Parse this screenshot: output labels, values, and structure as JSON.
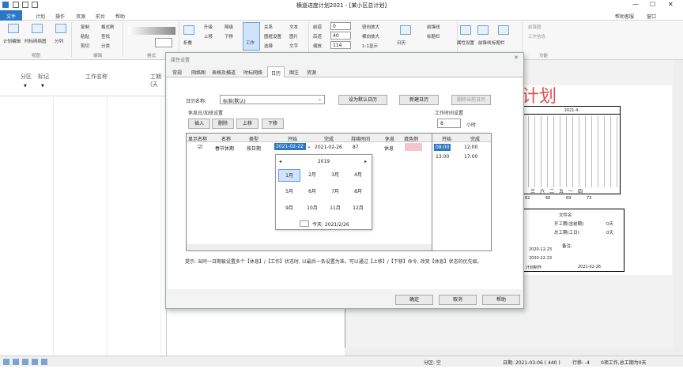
{
  "app": {
    "title": "横道进度计划2021 - [某小区总计划]"
  },
  "tabs": [
    "文件",
    "计划",
    "操作",
    "资源",
    "前台",
    "帮助"
  ],
  "ribbon": {
    "right_help": "帮助客服",
    "right_window": "窗口",
    "items": [
      "计划编辑",
      "时标网络图",
      "分列",
      "复制",
      "粘贴",
      "剪切",
      "格式刷",
      "查找",
      "分类",
      "折叠",
      "升级",
      "上移",
      "降级",
      "下移",
      "工作",
      "关系",
      "图框设置",
      "选择",
      "文本",
      "图片",
      "文字",
      "前道",
      "后道",
      "缩放",
      "竖向放大",
      "横向放大",
      "1:1显示",
      "24",
      "40",
      "114",
      "0",
      "前锋线",
      "标题栏",
      "日历",
      "属性设置",
      "前锋图",
      "工作信息",
      "隐藏",
      "显示"
    ],
    "groups": [
      "视图",
      "编辑",
      "格式",
      "对象",
      "视图",
      "显示",
      "配置",
      "功能"
    ]
  },
  "left_header": {
    "col_area": "分区",
    "col_mark": "标记",
    "col_name": "工作名称",
    "col_days": "工期(天"
  },
  "right_pane": {
    "big_title": "计划",
    "cal_header": "2021.4",
    "weekdays": [
      "三",
      "六",
      "二",
      "五",
      "一",
      "四"
    ],
    "week_nums": [
      "62",
      "66",
      "69",
      "73"
    ],
    "info": {
      "label1": "文件名",
      "label2": "开工期(含前期)",
      "label3": "总工期(工日)",
      "val2": "0天",
      "val3": "0天",
      "remark": "备注:",
      "d1": "2020-12-23",
      "d2": "2020-12-23",
      "d3": "2021-02-26",
      "footer": "计划制作"
    }
  },
  "dialog": {
    "title": "属性设置",
    "tabs": [
      "常规",
      "网络图",
      "表格及横道",
      "时标网络",
      "日历",
      "图注",
      "资源"
    ],
    "active_tab": "日历",
    "calendar_label": "日历名称:",
    "calendar_value": "标准(默认)",
    "btn_default": "设为默认日历",
    "btn_new": "新建日历",
    "btn_delete": "删除当前日历",
    "holiday_section": "休息日/加班设置",
    "btn_insert": "插入",
    "btn_remove": "删除",
    "btn_up": "上移",
    "btn_down": "下移",
    "columns": [
      "显示名称",
      "名称",
      "类型",
      "开始",
      "完成",
      "持续时间",
      "休息",
      "填色例"
    ],
    "row": {
      "name": "春节休期",
      "type": "按日期",
      "start": "2021-02-22",
      "end": "2021-02-26",
      "duration": "87",
      "rest": "休息"
    },
    "work_time_section": "工作时间设置",
    "hours_value": "8",
    "hours_unit": "小时",
    "wt_columns": [
      "开始",
      "完成"
    ],
    "wt_rows": [
      [
        "08:00",
        "12:00"
      ],
      [
        "13:00",
        "17:00"
      ]
    ],
    "calendar_popup": {
      "year": "2019",
      "months": [
        "1月",
        "2月",
        "3月",
        "4月",
        "5月",
        "6月",
        "7月",
        "8月",
        "9月",
        "10月",
        "11月",
        "12月"
      ],
      "today": "今天: 2021/2/26"
    },
    "hint": "提示: 当同一日期被设置多个【休息】/【工作】状态时, 以最后一条设置为准。可以通过【上移】/【下移】命令, 改变【休息】状态的优先级。",
    "btn_ok": "确定",
    "btn_cancel": "取消",
    "btn_help": "帮助"
  },
  "status": {
    "area": "分区: 空",
    "date": "日期: 2021-03-06 ( 440 )",
    "offset": "行移: -4",
    "summary": "0项工作,总工期为0天"
  }
}
